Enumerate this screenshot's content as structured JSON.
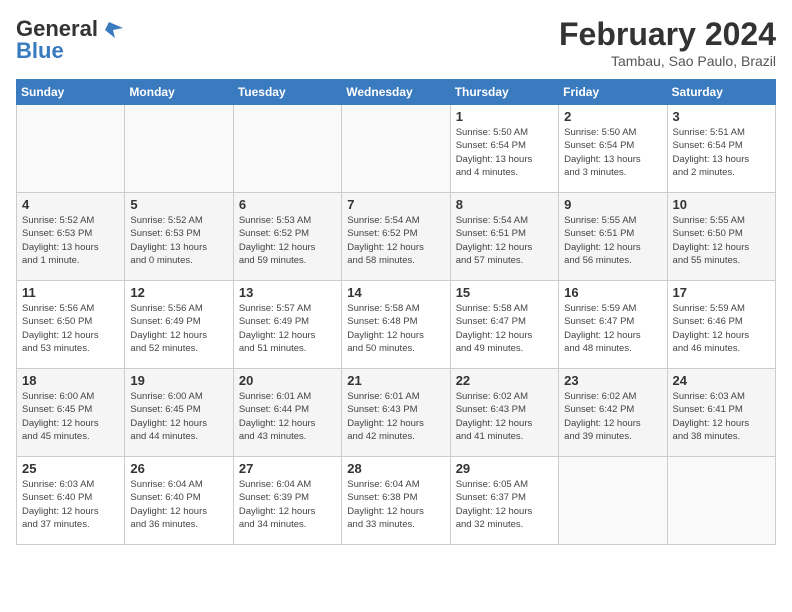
{
  "header": {
    "logo_line1": "General",
    "logo_line2": "Blue",
    "month": "February 2024",
    "location": "Tambau, Sao Paulo, Brazil"
  },
  "weekdays": [
    "Sunday",
    "Monday",
    "Tuesday",
    "Wednesday",
    "Thursday",
    "Friday",
    "Saturday"
  ],
  "weeks": [
    [
      {
        "day": "",
        "info": ""
      },
      {
        "day": "",
        "info": ""
      },
      {
        "day": "",
        "info": ""
      },
      {
        "day": "",
        "info": ""
      },
      {
        "day": "1",
        "info": "Sunrise: 5:50 AM\nSunset: 6:54 PM\nDaylight: 13 hours\nand 4 minutes."
      },
      {
        "day": "2",
        "info": "Sunrise: 5:50 AM\nSunset: 6:54 PM\nDaylight: 13 hours\nand 3 minutes."
      },
      {
        "day": "3",
        "info": "Sunrise: 5:51 AM\nSunset: 6:54 PM\nDaylight: 13 hours\nand 2 minutes."
      }
    ],
    [
      {
        "day": "4",
        "info": "Sunrise: 5:52 AM\nSunset: 6:53 PM\nDaylight: 13 hours\nand 1 minute."
      },
      {
        "day": "5",
        "info": "Sunrise: 5:52 AM\nSunset: 6:53 PM\nDaylight: 13 hours\nand 0 minutes."
      },
      {
        "day": "6",
        "info": "Sunrise: 5:53 AM\nSunset: 6:52 PM\nDaylight: 12 hours\nand 59 minutes."
      },
      {
        "day": "7",
        "info": "Sunrise: 5:54 AM\nSunset: 6:52 PM\nDaylight: 12 hours\nand 58 minutes."
      },
      {
        "day": "8",
        "info": "Sunrise: 5:54 AM\nSunset: 6:51 PM\nDaylight: 12 hours\nand 57 minutes."
      },
      {
        "day": "9",
        "info": "Sunrise: 5:55 AM\nSunset: 6:51 PM\nDaylight: 12 hours\nand 56 minutes."
      },
      {
        "day": "10",
        "info": "Sunrise: 5:55 AM\nSunset: 6:50 PM\nDaylight: 12 hours\nand 55 minutes."
      }
    ],
    [
      {
        "day": "11",
        "info": "Sunrise: 5:56 AM\nSunset: 6:50 PM\nDaylight: 12 hours\nand 53 minutes."
      },
      {
        "day": "12",
        "info": "Sunrise: 5:56 AM\nSunset: 6:49 PM\nDaylight: 12 hours\nand 52 minutes."
      },
      {
        "day": "13",
        "info": "Sunrise: 5:57 AM\nSunset: 6:49 PM\nDaylight: 12 hours\nand 51 minutes."
      },
      {
        "day": "14",
        "info": "Sunrise: 5:58 AM\nSunset: 6:48 PM\nDaylight: 12 hours\nand 50 minutes."
      },
      {
        "day": "15",
        "info": "Sunrise: 5:58 AM\nSunset: 6:47 PM\nDaylight: 12 hours\nand 49 minutes."
      },
      {
        "day": "16",
        "info": "Sunrise: 5:59 AM\nSunset: 6:47 PM\nDaylight: 12 hours\nand 48 minutes."
      },
      {
        "day": "17",
        "info": "Sunrise: 5:59 AM\nSunset: 6:46 PM\nDaylight: 12 hours\nand 46 minutes."
      }
    ],
    [
      {
        "day": "18",
        "info": "Sunrise: 6:00 AM\nSunset: 6:45 PM\nDaylight: 12 hours\nand 45 minutes."
      },
      {
        "day": "19",
        "info": "Sunrise: 6:00 AM\nSunset: 6:45 PM\nDaylight: 12 hours\nand 44 minutes."
      },
      {
        "day": "20",
        "info": "Sunrise: 6:01 AM\nSunset: 6:44 PM\nDaylight: 12 hours\nand 43 minutes."
      },
      {
        "day": "21",
        "info": "Sunrise: 6:01 AM\nSunset: 6:43 PM\nDaylight: 12 hours\nand 42 minutes."
      },
      {
        "day": "22",
        "info": "Sunrise: 6:02 AM\nSunset: 6:43 PM\nDaylight: 12 hours\nand 41 minutes."
      },
      {
        "day": "23",
        "info": "Sunrise: 6:02 AM\nSunset: 6:42 PM\nDaylight: 12 hours\nand 39 minutes."
      },
      {
        "day": "24",
        "info": "Sunrise: 6:03 AM\nSunset: 6:41 PM\nDaylight: 12 hours\nand 38 minutes."
      }
    ],
    [
      {
        "day": "25",
        "info": "Sunrise: 6:03 AM\nSunset: 6:40 PM\nDaylight: 12 hours\nand 37 minutes."
      },
      {
        "day": "26",
        "info": "Sunrise: 6:04 AM\nSunset: 6:40 PM\nDaylight: 12 hours\nand 36 minutes."
      },
      {
        "day": "27",
        "info": "Sunrise: 6:04 AM\nSunset: 6:39 PM\nDaylight: 12 hours\nand 34 minutes."
      },
      {
        "day": "28",
        "info": "Sunrise: 6:04 AM\nSunset: 6:38 PM\nDaylight: 12 hours\nand 33 minutes."
      },
      {
        "day": "29",
        "info": "Sunrise: 6:05 AM\nSunset: 6:37 PM\nDaylight: 12 hours\nand 32 minutes."
      },
      {
        "day": "",
        "info": ""
      },
      {
        "day": "",
        "info": ""
      }
    ]
  ]
}
